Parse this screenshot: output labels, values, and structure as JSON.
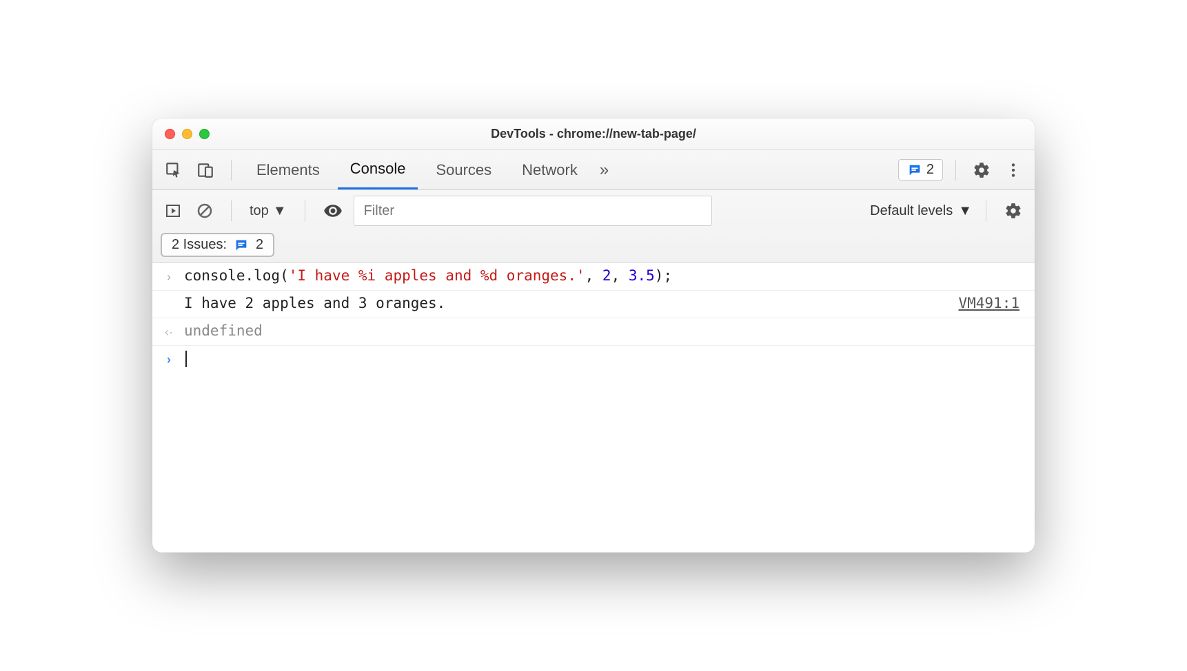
{
  "window": {
    "title": "DevTools - chrome://new-tab-page/"
  },
  "tabs": {
    "elements": "Elements",
    "console": "Console",
    "sources": "Sources",
    "network": "Network"
  },
  "issues_badge": {
    "count": "2"
  },
  "toolbar": {
    "context": "top",
    "filter_placeholder": "Filter",
    "levels": "Default levels"
  },
  "issues_chip": {
    "label": "2 Issues:",
    "count": "2"
  },
  "console": {
    "input": {
      "method": "console.log",
      "open": "(",
      "string": "'I have %i apples and %d oranges.'",
      "c1": ", ",
      "arg1": "2",
      "c2": ", ",
      "arg2": "3.5",
      "close": ");"
    },
    "output": "I have 2 apples and 3 oranges.",
    "source": "VM491:1",
    "return": "undefined"
  }
}
